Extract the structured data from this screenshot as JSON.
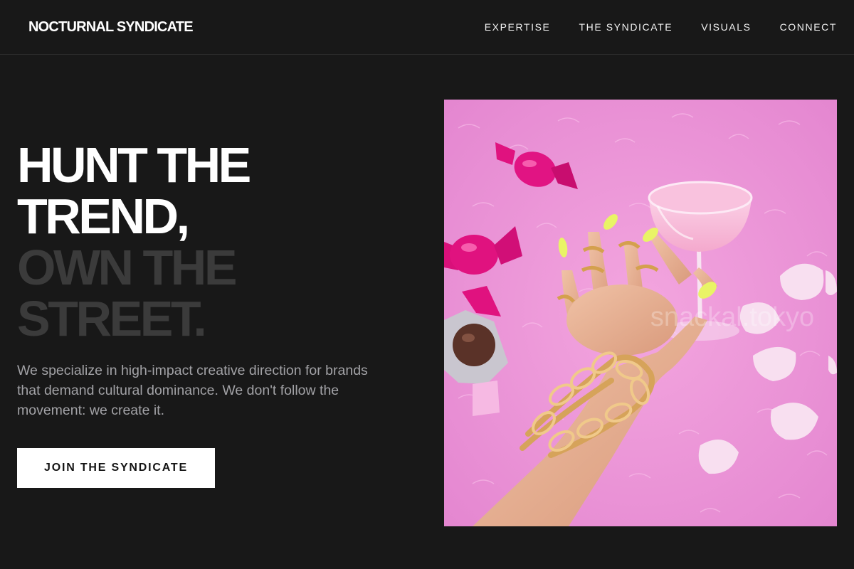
{
  "brand": {
    "name": "NOCTURNAL SYNDICATE"
  },
  "nav": {
    "items": [
      {
        "label": "EXPERTISE"
      },
      {
        "label": "THE SYNDICATE"
      },
      {
        "label": "VISUALS"
      },
      {
        "label": "CONNECT"
      }
    ]
  },
  "hero": {
    "headline_lines": [
      "HUNT THE",
      "TREND,",
      "OWN THE",
      "STREET."
    ],
    "description": "We specialize in high-impact creative direction for brands that demand cultural dominance. We don't follow the movement: we create it.",
    "cta_label": "JOIN THE SYNDICATE",
    "image_watermark": "snackal.tokyo"
  },
  "colors": {
    "background": "#181818",
    "headline_bright": "#ffffff",
    "headline_dim": "#3b3b3b",
    "body_text": "#a2a2a6",
    "button_bg": "#ffffff",
    "button_text": "#141414",
    "photo_pink": "#ec8fd6"
  }
}
